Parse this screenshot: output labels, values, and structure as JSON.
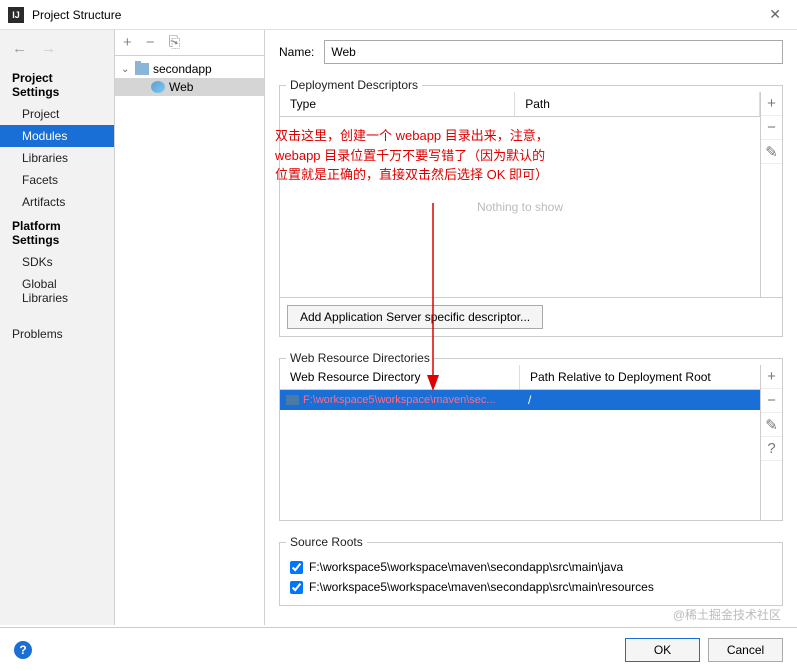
{
  "window": {
    "title": "Project Structure"
  },
  "sidebar": {
    "section1": "Project Settings",
    "items1": [
      "Project",
      "Modules",
      "Libraries",
      "Facets",
      "Artifacts"
    ],
    "section2": "Platform Settings",
    "items2": [
      "SDKs",
      "Global Libraries"
    ],
    "problems": "Problems"
  },
  "tree": {
    "root": "secondapp",
    "child": "Web"
  },
  "main": {
    "name_label": "Name:",
    "name_value": "Web",
    "dd_legend": "Deployment Descriptors",
    "dd_cols": {
      "type": "Type",
      "path": "Path"
    },
    "dd_empty": "Nothing to show",
    "dd_button": "Add Application Server specific descriptor...",
    "wrd_legend": "Web Resource Directories",
    "wrd_cols": {
      "dir": "Web Resource Directory",
      "rel": "Path Relative to Deployment Root"
    },
    "wrd_row": {
      "path": "F:\\workspace5\\workspace\\maven\\sec...",
      "rel": "/"
    },
    "sr_legend": "Source Roots",
    "sr_rows": [
      "F:\\workspace5\\workspace\\maven\\secondapp\\src\\main\\java",
      "F:\\workspace5\\workspace\\maven\\secondapp\\src\\main\\resources"
    ]
  },
  "footer": {
    "ok": "OK",
    "cancel": "Cancel"
  },
  "annotation": "双击这里，创建一个 webapp 目录出来，注意，webapp 目录位置千万不要写错了（因为默认的位置就是正确的，直接双击然后选择 OK 即可）",
  "watermark": "@稀土掘金技术社区"
}
